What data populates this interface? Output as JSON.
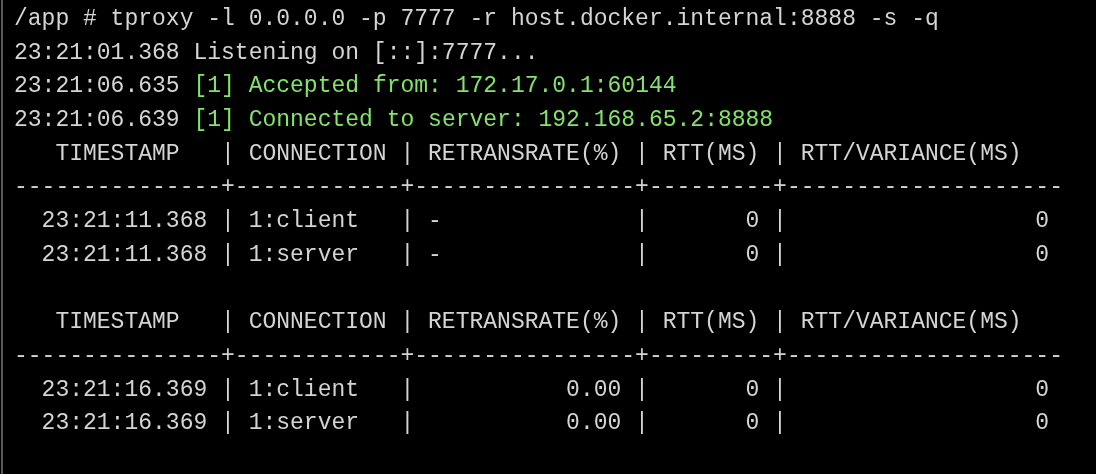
{
  "terminal": {
    "lines": [
      {
        "kind": "text",
        "text": "/app # tproxy -l 0.0.0.0 -p 7777 -r host.docker.internal:8888 -s -q"
      },
      {
        "kind": "text",
        "text": "23:21:01.368 Listening on [::]:7777..."
      },
      {
        "kind": "log",
        "timestamp": "23:21:06.635",
        "message": "[1] Accepted from: 172.17.0.1:60144"
      },
      {
        "kind": "log",
        "timestamp": "23:21:06.639",
        "message": "[1] Connected to server: 192.168.65.2:8888"
      },
      {
        "kind": "text",
        "text": "   TIMESTAMP   | CONNECTION | RETRANSRATE(%) | RTT(MS) | RTT/VARIANCE(MS)"
      },
      {
        "kind": "text",
        "text": "---------------+------------+----------------+---------+--------------------"
      },
      {
        "kind": "text",
        "text": "  23:21:11.368 | 1:client   | -              |       0 |                  0"
      },
      {
        "kind": "text",
        "text": "  23:21:11.368 | 1:server   | -              |       0 |                  0"
      },
      {
        "kind": "blank"
      },
      {
        "kind": "text",
        "text": "   TIMESTAMP   | CONNECTION | RETRANSRATE(%) | RTT(MS) | RTT/VARIANCE(MS)"
      },
      {
        "kind": "text",
        "text": "---------------+------------+----------------+---------+--------------------"
      },
      {
        "kind": "text",
        "text": "  23:21:16.369 | 1:client   |           0.00 |       0 |                  0"
      },
      {
        "kind": "text",
        "text": "  23:21:16.369 | 1:server   |           0.00 |       0 |                  0"
      }
    ]
  }
}
